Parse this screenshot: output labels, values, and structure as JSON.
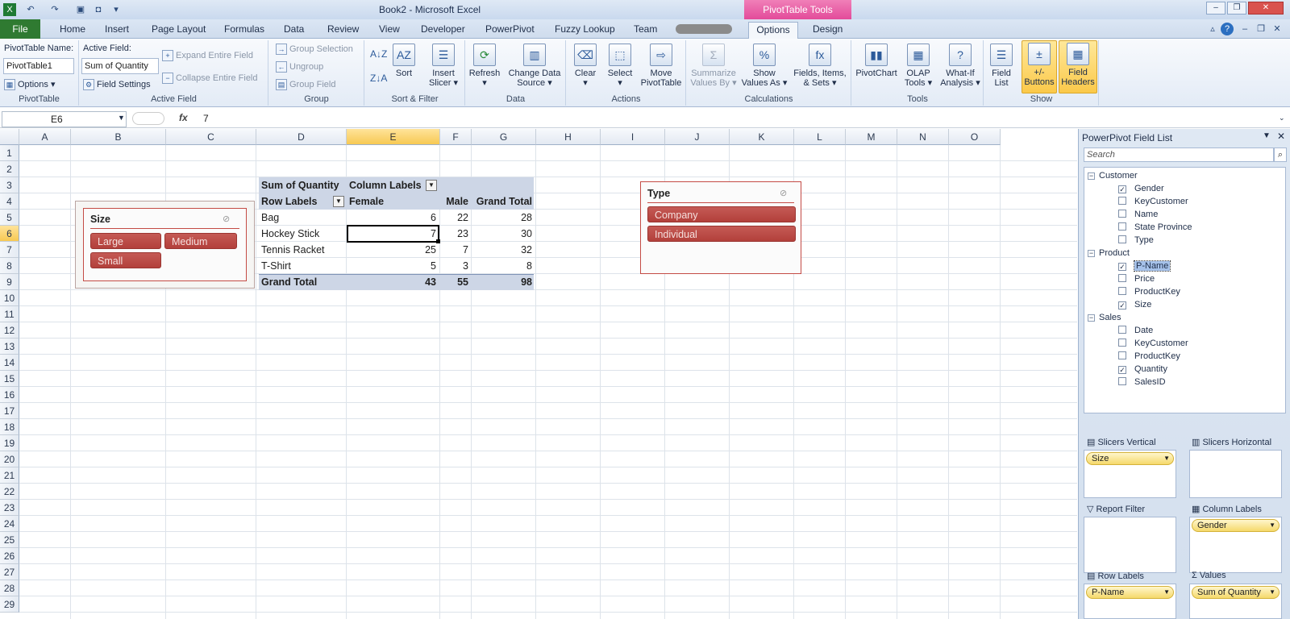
{
  "window": {
    "title": "Book2 - Microsoft Excel",
    "context_tab_group": "PivotTable Tools"
  },
  "tabs": [
    "File",
    "Home",
    "Insert",
    "Page Layout",
    "Formulas",
    "Data",
    "Review",
    "View",
    "Developer",
    "PowerPivot",
    "Fuzzy Lookup",
    "Team",
    "Options",
    "Design"
  ],
  "ribbon": {
    "pivottable": {
      "name_label": "PivotTable Name:",
      "name_value": "PivotTable1",
      "options": "Options",
      "group": "PivotTable"
    },
    "active_field": {
      "label": "Active Field:",
      "value": "Sum of Quantity",
      "settings": "Field Settings",
      "expand": "Expand Entire Field",
      "collapse": "Collapse Entire Field",
      "group": "Active Field"
    },
    "group": {
      "selection": "Group Selection",
      "ungroup": "Ungroup",
      "field": "Group Field",
      "group": "Group"
    },
    "sort_filter": {
      "sort": "Sort",
      "insert_slicer_1": "Insert",
      "insert_slicer_2": "Slicer",
      "group": "Sort & Filter"
    },
    "data": {
      "refresh": "Refresh",
      "change_1": "Change Data",
      "change_2": "Source",
      "group": "Data"
    },
    "actions": {
      "clear": "Clear",
      "select": "Select",
      "move_1": "Move",
      "move_2": "PivotTable",
      "group": "Actions"
    },
    "calculations": {
      "summarize_1": "Summarize",
      "summarize_2": "Values By",
      "show_1": "Show",
      "show_2": "Values As",
      "fields_1": "Fields, Items,",
      "fields_2": "& Sets",
      "group": "Calculations"
    },
    "tools": {
      "pivotchart": "PivotChart",
      "olap_1": "OLAP",
      "olap_2": "Tools",
      "whatif_1": "What-If",
      "whatif_2": "Analysis",
      "group": "Tools"
    },
    "show": {
      "fieldlist_1": "Field",
      "fieldlist_2": "List",
      "buttons_1": "+/-",
      "buttons_2": "Buttons",
      "headers_1": "Field",
      "headers_2": "Headers",
      "group": "Show"
    }
  },
  "formula_bar": {
    "name_box": "E6",
    "fx": "fx",
    "value": "7"
  },
  "columns": [
    "A",
    "B",
    "C",
    "D",
    "E",
    "F",
    "G",
    "H",
    "I",
    "J",
    "K",
    "L",
    "M",
    "N",
    "O"
  ],
  "rows": [
    "1",
    "2",
    "3",
    "4",
    "5",
    "6",
    "7",
    "8",
    "9",
    "10",
    "11",
    "12",
    "13",
    "14",
    "15",
    "16",
    "17",
    "18",
    "19",
    "20",
    "21",
    "22",
    "23",
    "24",
    "25",
    "26",
    "27",
    "28",
    "29"
  ],
  "pivot": {
    "header_1": "Sum of Quantity",
    "header_2": "Column Labels",
    "row_labels": "Row Labels",
    "col_female": "Female",
    "col_male": "Male",
    "col_total": "Grand Total",
    "rows": [
      {
        "label": "Bag",
        "female": "6",
        "male": "22",
        "total": "28"
      },
      {
        "label": "Hockey Stick",
        "female": "7",
        "male": "23",
        "total": "30"
      },
      {
        "label": "Tennis Racket",
        "female": "25",
        "male": "7",
        "total": "32"
      },
      {
        "label": "T-Shirt",
        "female": "5",
        "male": "3",
        "total": "8"
      }
    ],
    "grand": {
      "label": "Grand Total",
      "female": "43",
      "male": "55",
      "total": "98"
    }
  },
  "slicer_size": {
    "title": "Size",
    "items": [
      "Large",
      "Medium",
      "Small"
    ]
  },
  "slicer_type": {
    "title": "Type",
    "items": [
      "Company",
      "Individual"
    ]
  },
  "field_list": {
    "title": "PowerPivot Field List",
    "search_placeholder": "Search",
    "tables": [
      {
        "name": "Customer",
        "fields": [
          {
            "name": "Gender",
            "checked": true
          },
          {
            "name": "KeyCustomer",
            "checked": false
          },
          {
            "name": "Name",
            "checked": false
          },
          {
            "name": "State Province",
            "checked": false
          },
          {
            "name": "Type",
            "checked": false
          }
        ]
      },
      {
        "name": "Product",
        "fields": [
          {
            "name": "P-Name",
            "checked": true
          },
          {
            "name": "Price",
            "checked": false
          },
          {
            "name": "ProductKey",
            "checked": false
          },
          {
            "name": "Size",
            "checked": true
          }
        ]
      },
      {
        "name": "Sales",
        "fields": [
          {
            "name": "Date",
            "checked": false
          },
          {
            "name": "KeyCustomer",
            "checked": false
          },
          {
            "name": "ProductKey",
            "checked": false
          },
          {
            "name": "Quantity",
            "checked": true
          },
          {
            "name": "SalesID",
            "checked": false
          }
        ]
      }
    ],
    "areas": {
      "slicers_vertical": {
        "label": "Slicers Vertical",
        "value": "Size"
      },
      "slicers_horizontal": {
        "label": "Slicers Horizontal"
      },
      "report_filter": {
        "label": "Report Filter"
      },
      "column_labels": {
        "label": "Column Labels",
        "value": "Gender"
      },
      "row_labels": {
        "label": "Row Labels",
        "value": "P-Name"
      },
      "values": {
        "label": "Values",
        "value": "Sum of Quantity"
      }
    }
  }
}
